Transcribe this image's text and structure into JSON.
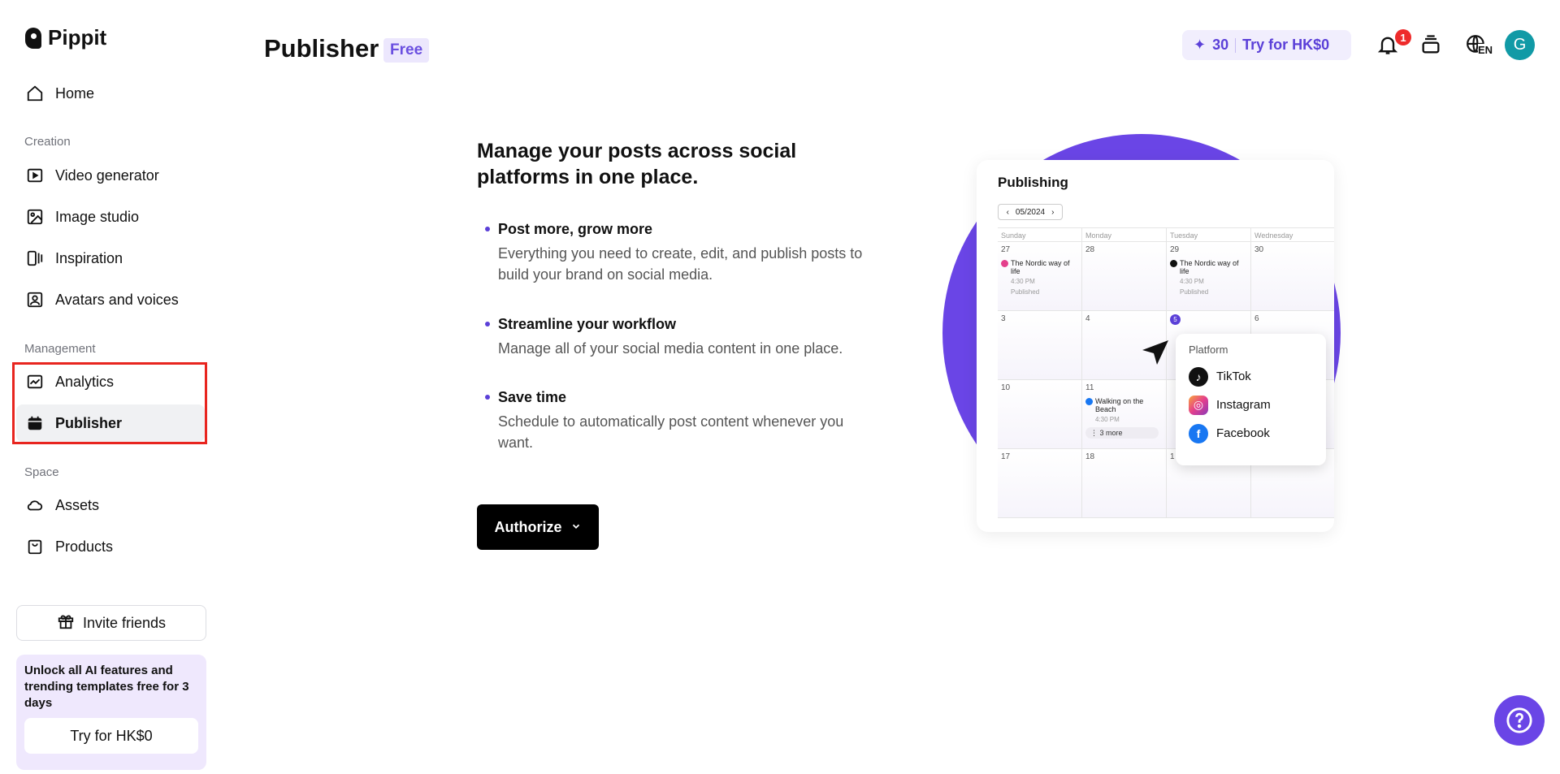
{
  "brand": {
    "name": "Pippit"
  },
  "sidebar": {
    "home": "Home",
    "sections": {
      "creation": "Creation",
      "management": "Management",
      "space": "Space"
    },
    "items": [
      {
        "label": "Video generator",
        "icon": "video-generator-icon"
      },
      {
        "label": "Image studio",
        "icon": "image-studio-icon"
      },
      {
        "label": "Inspiration",
        "icon": "inspiration-icon"
      },
      {
        "label": "Avatars and voices",
        "icon": "avatar-voice-icon"
      },
      {
        "label": "Analytics",
        "icon": "analytics-icon"
      },
      {
        "label": "Publisher",
        "icon": "calendar-icon"
      },
      {
        "label": "Assets",
        "icon": "cloud-icon"
      },
      {
        "label": "Products",
        "icon": "bag-icon"
      }
    ],
    "invite": "Invite friends",
    "promo": {
      "text": "Unlock all AI features and trending templates free for 3 days",
      "button": "Try for HK$0"
    }
  },
  "header": {
    "title": "Publisher",
    "badge": "Free",
    "credits": "30",
    "trial": "Try for HK$0",
    "notifications": "1",
    "lang": "EN",
    "avatar_initial": "G"
  },
  "main": {
    "heading": "Manage your posts across social platforms in one place.",
    "features": [
      {
        "title": "Post more, grow more",
        "desc": "Everything you need to create, edit, and publish posts to build your brand on social media."
      },
      {
        "title": "Streamline your workflow",
        "desc": "Manage all of your social media content in one place."
      },
      {
        "title": "Save time",
        "desc": "Schedule to automatically post content whenever you want."
      }
    ],
    "authorize": "Authorize"
  },
  "illustration": {
    "title": "Publishing",
    "month": "05/2024",
    "days": [
      "Sunday",
      "Monday",
      "Tuesday",
      "Wednesday"
    ],
    "rows": [
      [
        "27",
        "28",
        "29",
        "30"
      ],
      [
        "3",
        "4",
        "5",
        "6"
      ],
      [
        "10",
        "11",
        "",
        ""
      ],
      [
        "17",
        "18",
        "1",
        ""
      ]
    ],
    "event1": "The Nordic way of life",
    "event_time": "4:30 PM",
    "event_status": "Published",
    "event2": "Walking on the Beach",
    "more": "3 more",
    "platform_label": "Platform",
    "platforms": [
      "TikTok",
      "Instagram",
      "Facebook"
    ]
  },
  "colors": {
    "accent": "#6a45e6",
    "highlight": "#e8251f",
    "avatar": "#119aa6"
  }
}
